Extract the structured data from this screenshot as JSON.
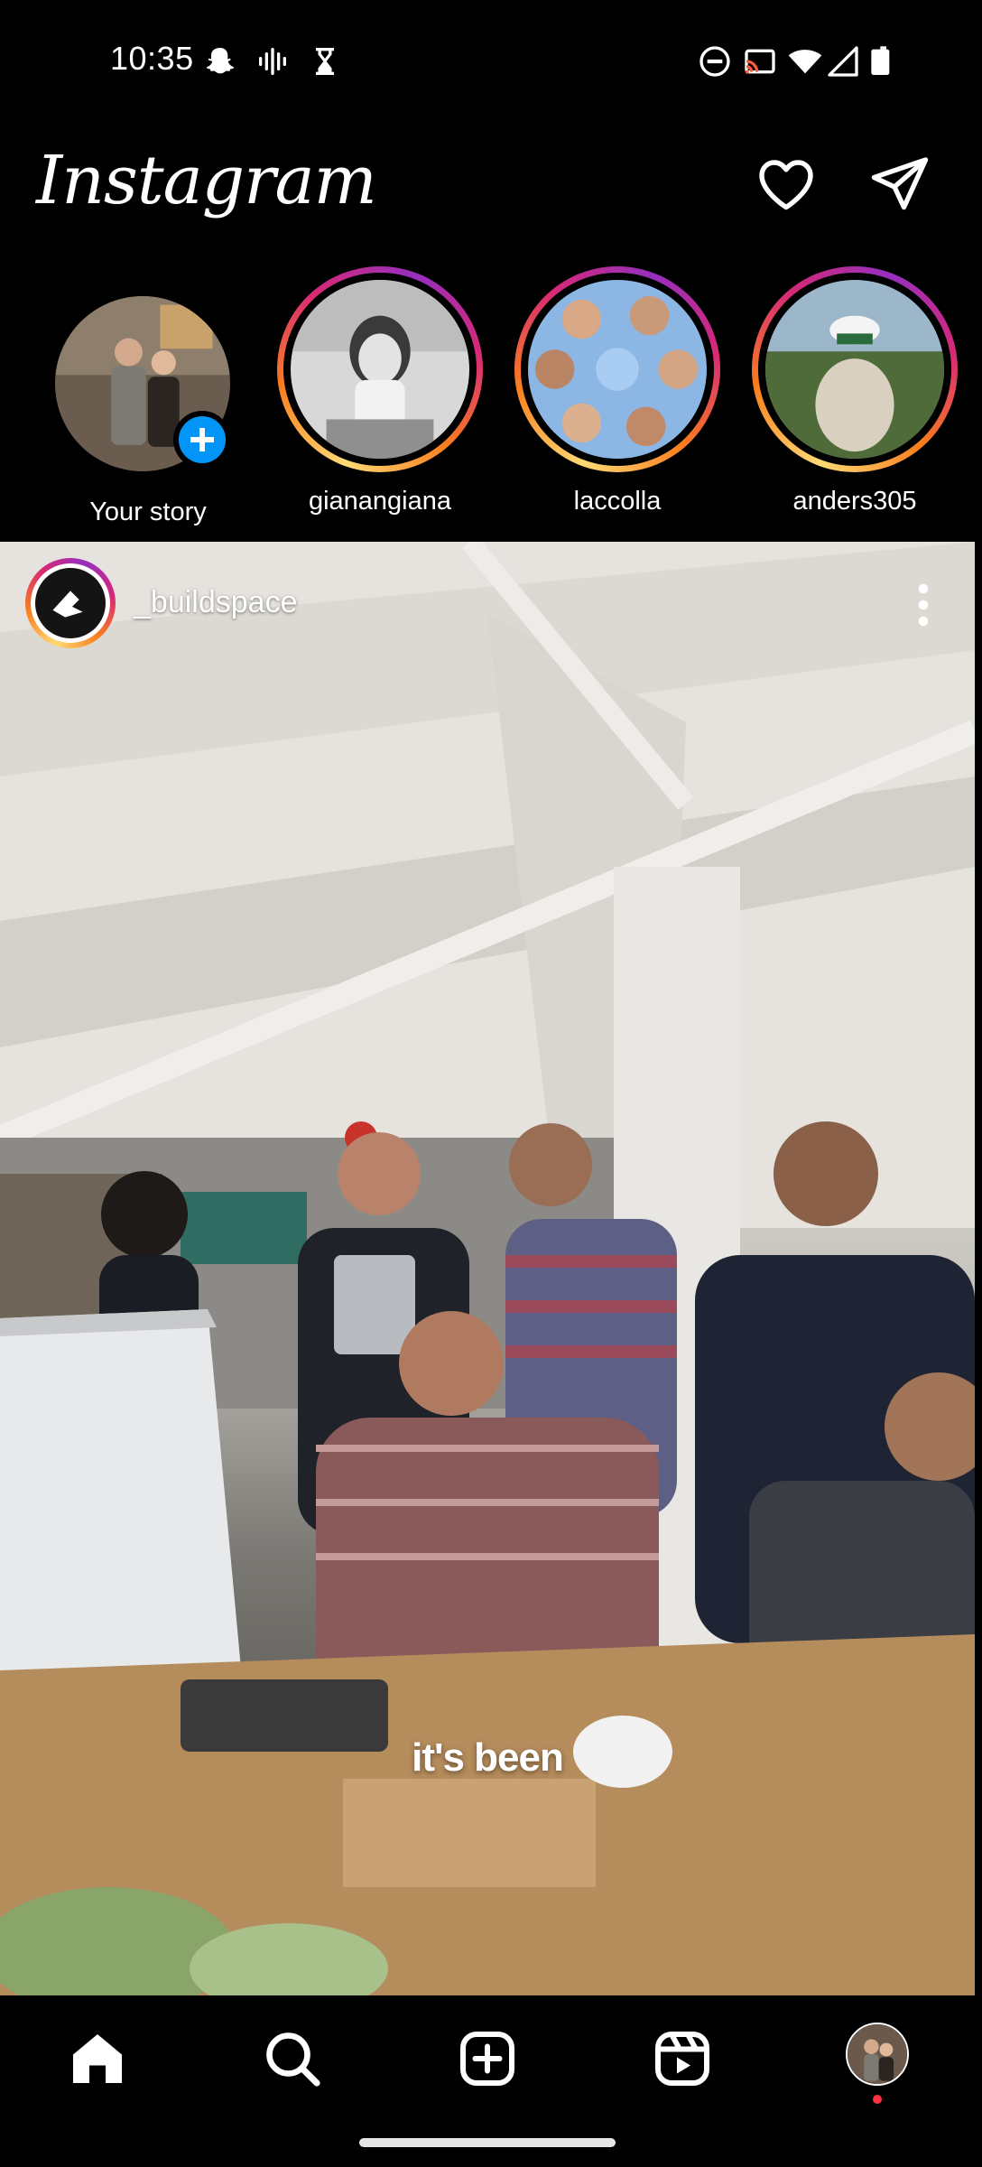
{
  "status_bar": {
    "time": "10:35",
    "left_icons": [
      "snapchat-icon",
      "voicemail-icon",
      "hourglass-icon"
    ],
    "right_icons": [
      "do-not-disturb-icon",
      "cast-icon",
      "wifi-icon",
      "signal-icon",
      "battery-icon"
    ]
  },
  "header": {
    "logo": "Instagram",
    "icons": [
      "heart-icon",
      "direct-message-icon"
    ]
  },
  "stories": [
    {
      "label": "Your story",
      "has_add_badge": true
    },
    {
      "label": "gianangiana"
    },
    {
      "label": "laccolla"
    },
    {
      "label": "anders305"
    }
  ],
  "post": {
    "username": "_buildspace",
    "caption_overlay": "it's been",
    "more_icon": "more-vertical-icon"
  },
  "bottom_nav": {
    "items": [
      "home-icon",
      "search-icon",
      "create-icon",
      "reels-icon",
      "profile-avatar"
    ],
    "active": "home-icon",
    "notification_dot_color": "#ff3040"
  },
  "colors": {
    "background": "#000000",
    "accent_blue": "#0095f6",
    "story_gradient": [
      "#feda75",
      "#fa7e1e",
      "#d62976",
      "#962fbf"
    ]
  }
}
